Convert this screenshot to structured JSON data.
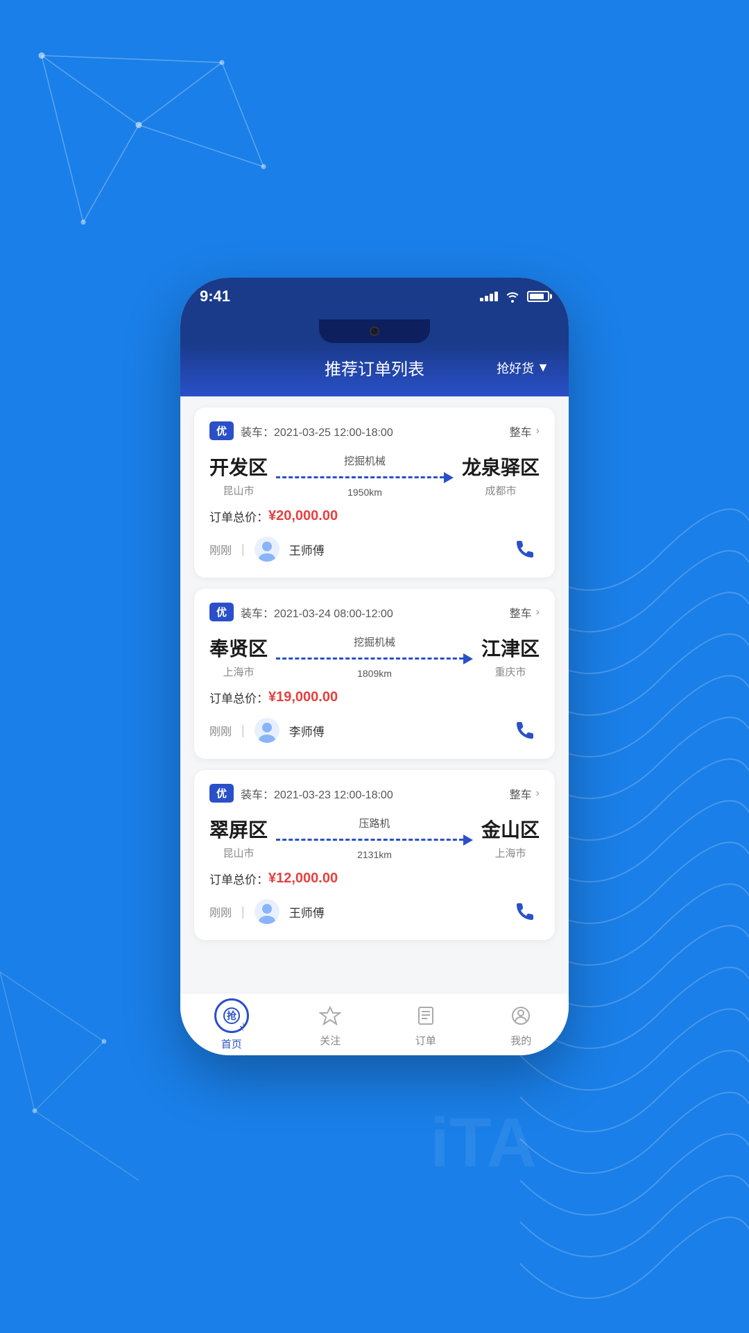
{
  "background": {
    "color": "#1a7fe8"
  },
  "phone": {
    "status_bar": {
      "time": "9:41",
      "signal_bars": [
        4,
        6,
        8,
        10
      ],
      "wifi": true,
      "battery_pct": 85
    },
    "header": {
      "title": "推荐订单列表",
      "filter_label": "抢好货"
    },
    "orders": [
      {
        "id": 1,
        "priority_badge": "优",
        "load_time": "装车：2021-03-25 12:00-18:00",
        "type": "整车",
        "origin_name": "开发区",
        "origin_city": "昆山市",
        "cargo_type": "挖掘机械",
        "distance": "1950km",
        "dest_name": "龙泉驿区",
        "dest_city": "成都市",
        "price_label": "订单总价：",
        "price_value": "¥20,000.00",
        "time_ago": "刚刚",
        "driver_name": "王师傅"
      },
      {
        "id": 2,
        "priority_badge": "优",
        "load_time": "装车：2021-03-24 08:00-12:00",
        "type": "整车",
        "origin_name": "奉贤区",
        "origin_city": "上海市",
        "cargo_type": "挖掘机械",
        "distance": "1809km",
        "dest_name": "江津区",
        "dest_city": "重庆市",
        "price_label": "订单总价：",
        "price_value": "¥19,000.00",
        "time_ago": "刚刚",
        "driver_name": "李师傅"
      },
      {
        "id": 3,
        "priority_badge": "优",
        "load_time": "装车：2021-03-23 12:00-18:00",
        "type": "整车",
        "origin_name": "翠屏区",
        "origin_city": "昆山市",
        "cargo_type": "压路机",
        "distance": "2131km",
        "dest_name": "金山区",
        "dest_city": "上海市",
        "price_label": "订单总价：",
        "price_value": "¥12,000.00",
        "time_ago": "刚刚",
        "driver_name": "王师傅"
      }
    ],
    "bottom_nav": {
      "items": [
        {
          "id": "home",
          "label": "首页",
          "active": true
        },
        {
          "id": "follow",
          "label": "关注",
          "active": false
        },
        {
          "id": "orders",
          "label": "订单",
          "active": false
        },
        {
          "id": "profile",
          "label": "我的",
          "active": false
        }
      ]
    }
  }
}
